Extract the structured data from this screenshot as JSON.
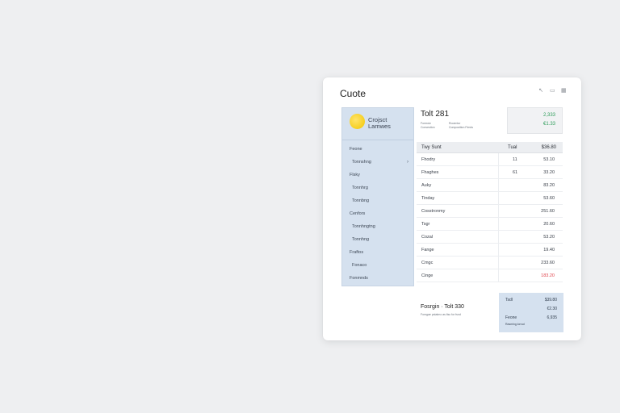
{
  "window": {
    "title": "Cuote",
    "controls": [
      "↖",
      "▭",
      "▦"
    ]
  },
  "sidebar": {
    "brand_line1": "Crojsct",
    "brand_line2": "Lamwes",
    "items": [
      {
        "label": "Feone",
        "sub": false,
        "chevron": ""
      },
      {
        "label": "Tonnshng",
        "sub": true,
        "chevron": "›"
      },
      {
        "label": "Flsky",
        "sub": false,
        "chevron": ""
      },
      {
        "label": "Tonnhrg",
        "sub": true,
        "chevron": ""
      },
      {
        "label": "Tonnbng",
        "sub": true,
        "chevron": ""
      },
      {
        "label": "Cenfors",
        "sub": false,
        "chevron": ""
      },
      {
        "label": "Tonnhngtng",
        "sub": true,
        "chevron": ""
      },
      {
        "label": "Tonnhng",
        "sub": true,
        "chevron": ""
      },
      {
        "label": "Fraftos",
        "sub": false,
        "chevron": ""
      },
      {
        "label": "Fonaco",
        "sub": true,
        "chevron": ""
      },
      {
        "label": "Fonmnds",
        "sub": false,
        "chevron": ""
      }
    ]
  },
  "header": {
    "title": "Tolt 281",
    "meta_left": [
      "Fomrotz",
      "Convestion"
    ],
    "meta_right": [
      "Rooentor",
      "Composition Fimds"
    ]
  },
  "summary": {
    "value1": "2,333",
    "value2": "€1.33",
    "color": "#2f9d5b"
  },
  "table": {
    "headers": [
      "Twy Sunt",
      "Tual",
      "$36.80"
    ],
    "rows": [
      {
        "name": "Fhodry",
        "qty": "11",
        "amount": "53.10",
        "red": false
      },
      {
        "name": "Fhaghes",
        "qty": "61",
        "amount": "33.20",
        "red": false
      },
      {
        "name": "Auky",
        "qty": "",
        "amount": "83.20",
        "red": false
      },
      {
        "name": "Tinday",
        "qty": "",
        "amount": "53.60",
        "red": false
      },
      {
        "name": "Cosstronmy",
        "qty": "",
        "amount": "251.60",
        "red": false
      },
      {
        "name": "Tsgr",
        "qty": "",
        "amount": "20.60",
        "red": false
      },
      {
        "name": "Cozal",
        "qty": "",
        "amount": "53.20",
        "red": false
      },
      {
        "name": "Fange",
        "qty": "",
        "amount": "19.40",
        "red": false
      },
      {
        "name": "Cmgc",
        "qty": "",
        "amount": "233.60",
        "red": false
      },
      {
        "name": "Cinge",
        "qty": "",
        "amount": "183.20",
        "red": true
      }
    ]
  },
  "footer": {
    "total_label": "Fosrgin · Tolt 330",
    "subtext": "Fomgae pstatmo as ltsc for fsnd"
  },
  "totals": {
    "label1": "Tsdl",
    "value1": "$39.80",
    "value2": "€2.30",
    "label2": "Feone",
    "value3": "6,935",
    "note": "Rasming lorrud"
  },
  "colors": {
    "accent_red": "#e0414a",
    "sidebar_bg": "#d5e1ef"
  }
}
